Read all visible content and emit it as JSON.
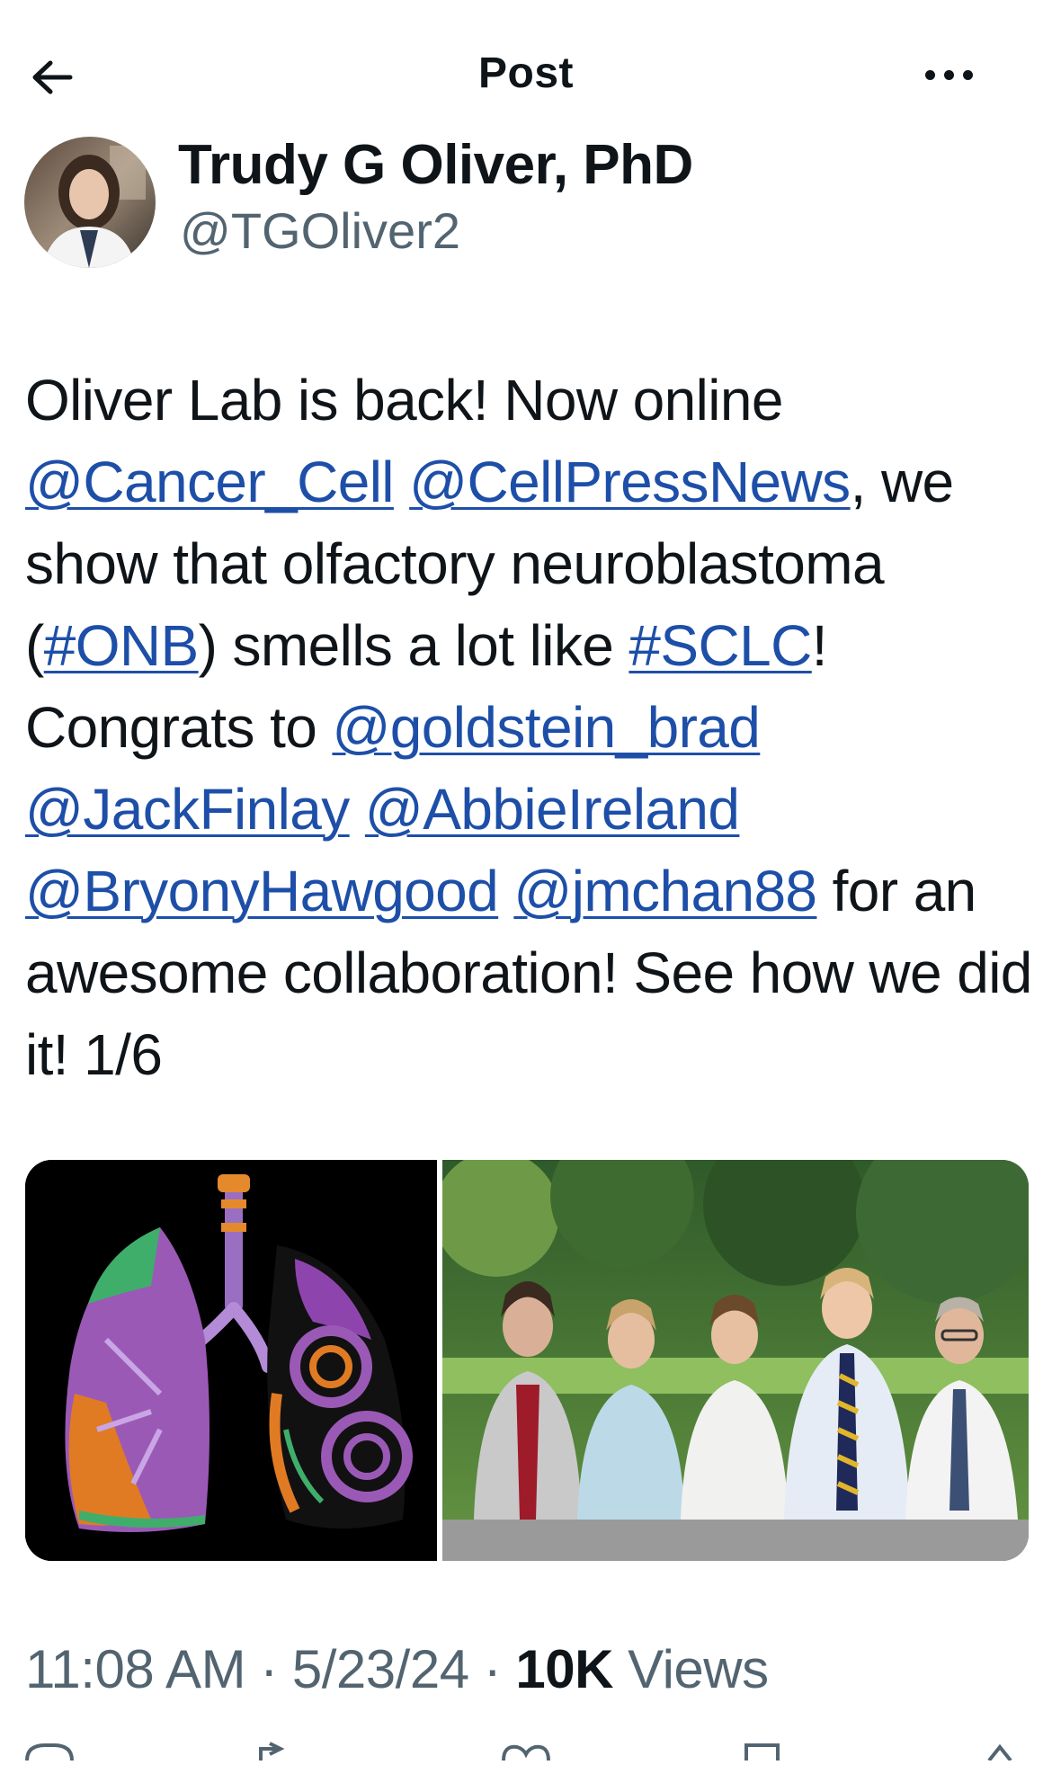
{
  "header": {
    "title": "Post"
  },
  "author": {
    "name": "Trudy G Oliver, PhD",
    "handle": "@TGOliver2"
  },
  "tweet": {
    "segments": [
      {
        "text": "Oliver Lab is back! Now online ",
        "link": false
      },
      {
        "text": "@Cancer_Cell",
        "link": true
      },
      {
        "text": " ",
        "link": false
      },
      {
        "text": "@CellPressNews",
        "link": true
      },
      {
        "text": ", we show that olfactory neuroblastoma (",
        "link": false
      },
      {
        "text": "#ONB",
        "link": true
      },
      {
        "text": ") smells a lot like ",
        "link": false
      },
      {
        "text": "#SCLC",
        "link": true
      },
      {
        "text": "! Congrats to ",
        "link": false
      },
      {
        "text": "@goldstein_brad",
        "link": true
      },
      {
        "text": " ",
        "link": false
      },
      {
        "text": "@JackFinlay",
        "link": true
      },
      {
        "text": " ",
        "link": false
      },
      {
        "text": "@AbbieIreland",
        "link": true
      },
      {
        "text": " ",
        "link": false
      },
      {
        "text": "@BryonyHawgood",
        "link": true
      },
      {
        "text": " ",
        "link": false
      },
      {
        "text": "@jmchan88",
        "link": true
      },
      {
        "text": " for an awesome collaboration! See how we did it!  1/6",
        "link": false
      }
    ]
  },
  "meta": {
    "time": "11:08 AM",
    "separator": "·",
    "date": "5/23/24",
    "views_count": "10K",
    "views_label": "Views"
  },
  "colors": {
    "link": "#1d4fa8",
    "secondary_text": "#536471",
    "primary_text": "#0f1419"
  },
  "icons": {
    "back": "arrow-left-icon",
    "more": "more-horizontal-icon"
  }
}
